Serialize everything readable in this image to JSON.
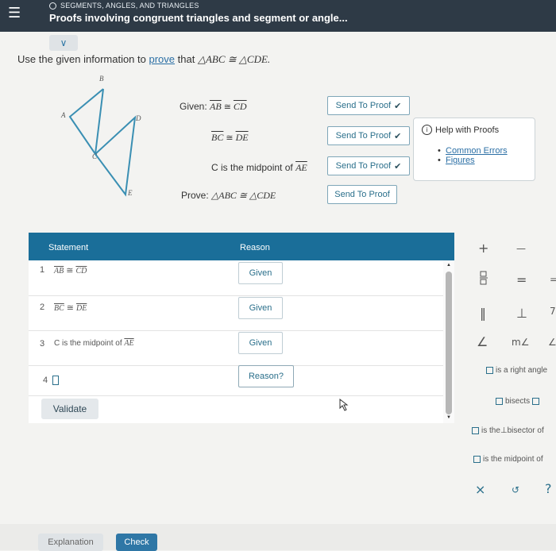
{
  "header": {
    "topic": "SEGMENTS, ANGLES, AND TRIANGLES",
    "title": "Proofs involving congruent triangles and segment or angle...",
    "collapse_icon": "∨",
    "menu_icon": "☰"
  },
  "problem": {
    "prefix": "Use the given information to",
    "link": "prove",
    "middle": "that",
    "statement": "△ABC ≅ △CDE."
  },
  "figure": {
    "labels": {
      "A": "A",
      "B": "B",
      "C": "C",
      "D": "D",
      "E": "E"
    }
  },
  "given": {
    "label": "Given:",
    "g1_left": "AB",
    "g1_right": "CD",
    "g2_left": "BC",
    "g2_right": "DE",
    "g3_text": "C is the midpoint of",
    "g3_seg": "AE",
    "prove_label": "Prove:",
    "prove_stmt": "△ABC ≅ △CDE",
    "cong": "≅"
  },
  "send_buttons": [
    {
      "label": "Send To Proof",
      "sent": "✔"
    },
    {
      "label": "Send To Proof",
      "sent": "✔"
    },
    {
      "label": "Send To Proof",
      "sent": "✔"
    },
    {
      "label": "Send To Proof",
      "sent": ""
    }
  ],
  "help": {
    "title": "Help with Proofs",
    "info_icon": "i",
    "bullet": "•",
    "links": [
      "Common Errors",
      "Figures"
    ]
  },
  "table": {
    "header_statement": "Statement",
    "header_reason": "Reason",
    "rows": [
      {
        "num": "1",
        "seg_left": "AB",
        "seg_right": "CD",
        "reason": "Given"
      },
      {
        "num": "2",
        "seg_left": "BC",
        "seg_right": "DE",
        "reason": "Given"
      },
      {
        "num": "3",
        "text": "C is the midpoint of",
        "seg": "AE",
        "reason": "Given"
      },
      {
        "num": "4",
        "reason": "Reason?"
      }
    ],
    "validate": "Validate"
  },
  "palette": {
    "plus": "+",
    "minus": "—",
    "equals": "=",
    "parallel": "‖",
    "perp": "⊥",
    "angle": "∠",
    "measure_angle": "m∠",
    "right_angle": "is a right angle",
    "bisects": "bisects",
    "perp_bisector_pre": "is the",
    "perp_bisector_sym": "⊥",
    "perp_bisector_post": "bisector of",
    "midpoint_of": "is the midpoint of",
    "close": "×",
    "undo": "↺",
    "help": "?"
  },
  "footer": {
    "explanation": "Explanation",
    "check": "Check"
  }
}
